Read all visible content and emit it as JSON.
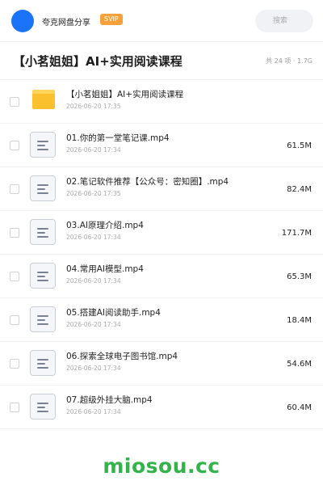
{
  "header": {
    "username": "夸克网盘分享",
    "badge": "SVIP",
    "search_placeholder": "搜索"
  },
  "folder": {
    "title": "【小茗姐姐】AI+实用阅读课程",
    "count": "共 24 项 · 1.7G"
  },
  "files": [
    {
      "name": "【小茗姐姐】AI+实用阅读课程",
      "date": "2026-06-20 17:35",
      "size": "",
      "type": "folder"
    },
    {
      "name": "01.你的第一堂笔记课.mp4",
      "date": "2026-06-20 17:34",
      "size": "61.5M",
      "type": "video"
    },
    {
      "name": "02.笔记软件推荐【公众号：密知圈】.mp4",
      "date": "2026-06-20 17:35",
      "size": "82.4M",
      "type": "video"
    },
    {
      "name": "03.AI原理介绍.mp4",
      "date": "2026-06-20 17:34",
      "size": "171.7M",
      "type": "video"
    },
    {
      "name": "04.常用AI模型.mp4",
      "date": "2026-06-20 17:34",
      "size": "65.3M",
      "type": "video"
    },
    {
      "name": "05.搭建AI阅读助手.mp4",
      "date": "2026-06-20 17:34",
      "size": "18.4M",
      "type": "video"
    },
    {
      "name": "06.探索全球电子图书馆.mp4",
      "date": "2026-06-20 17:34",
      "size": "54.6M",
      "type": "video"
    },
    {
      "name": "07.超级外挂大脑.mp4",
      "date": "2026-06-20 17:34",
      "size": "60.4M",
      "type": "video"
    }
  ],
  "watermark": "miosou.cc",
  "colors": {
    "accent": "#1a73f8",
    "badge": "#f6a13a",
    "folder": "#fbc02d",
    "watermark": "#34b34a"
  }
}
